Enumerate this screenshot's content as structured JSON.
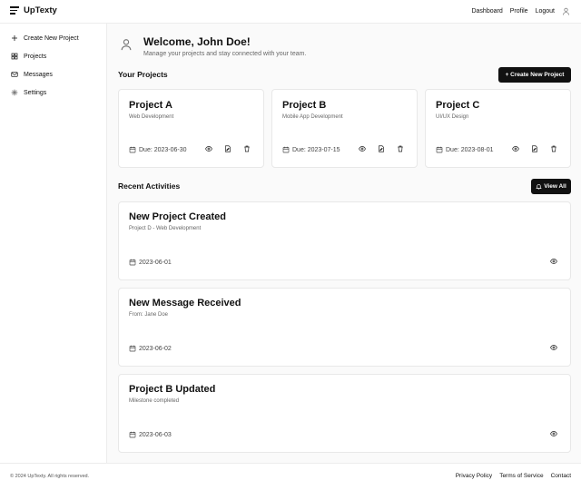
{
  "app": {
    "name": "UpTexty"
  },
  "topnav": {
    "items": [
      "Dashboard",
      "Profile",
      "Logout"
    ]
  },
  "sidebar": {
    "items": [
      {
        "label": "Create New Project",
        "icon": "plus-icon"
      },
      {
        "label": "Projects",
        "icon": "grid-icon"
      },
      {
        "label": "Messages",
        "icon": "mail-icon"
      },
      {
        "label": "Settings",
        "icon": "gear-icon"
      }
    ]
  },
  "welcome": {
    "title": "Welcome, John Doe!",
    "subtitle": "Manage your projects and stay connected with your team."
  },
  "projects": {
    "heading": "Your Projects",
    "create_label": "+ Create New Project",
    "items": [
      {
        "title": "Project A",
        "category": "Web Development",
        "due": "Due: 2023-06-30"
      },
      {
        "title": "Project B",
        "category": "Mobile App Development",
        "due": "Due: 2023-07-15"
      },
      {
        "title": "Project C",
        "category": "UI/UX Design",
        "due": "Due: 2023-08-01"
      }
    ]
  },
  "activities": {
    "heading": "Recent Activities",
    "view_all_label": "View All",
    "items": [
      {
        "title": "New Project Created",
        "detail": "Project D - Web Development",
        "date": "2023-06-01"
      },
      {
        "title": "New Message Received",
        "detail": "From: Jane Doe",
        "date": "2023-06-02"
      },
      {
        "title": "Project B Updated",
        "detail": "Milestone completed",
        "date": "2023-06-03"
      }
    ]
  },
  "footer": {
    "copyright": "© 2024 UpTexty. All rights reserved.",
    "links": [
      "Privacy Policy",
      "Terms of Service",
      "Contact"
    ]
  }
}
